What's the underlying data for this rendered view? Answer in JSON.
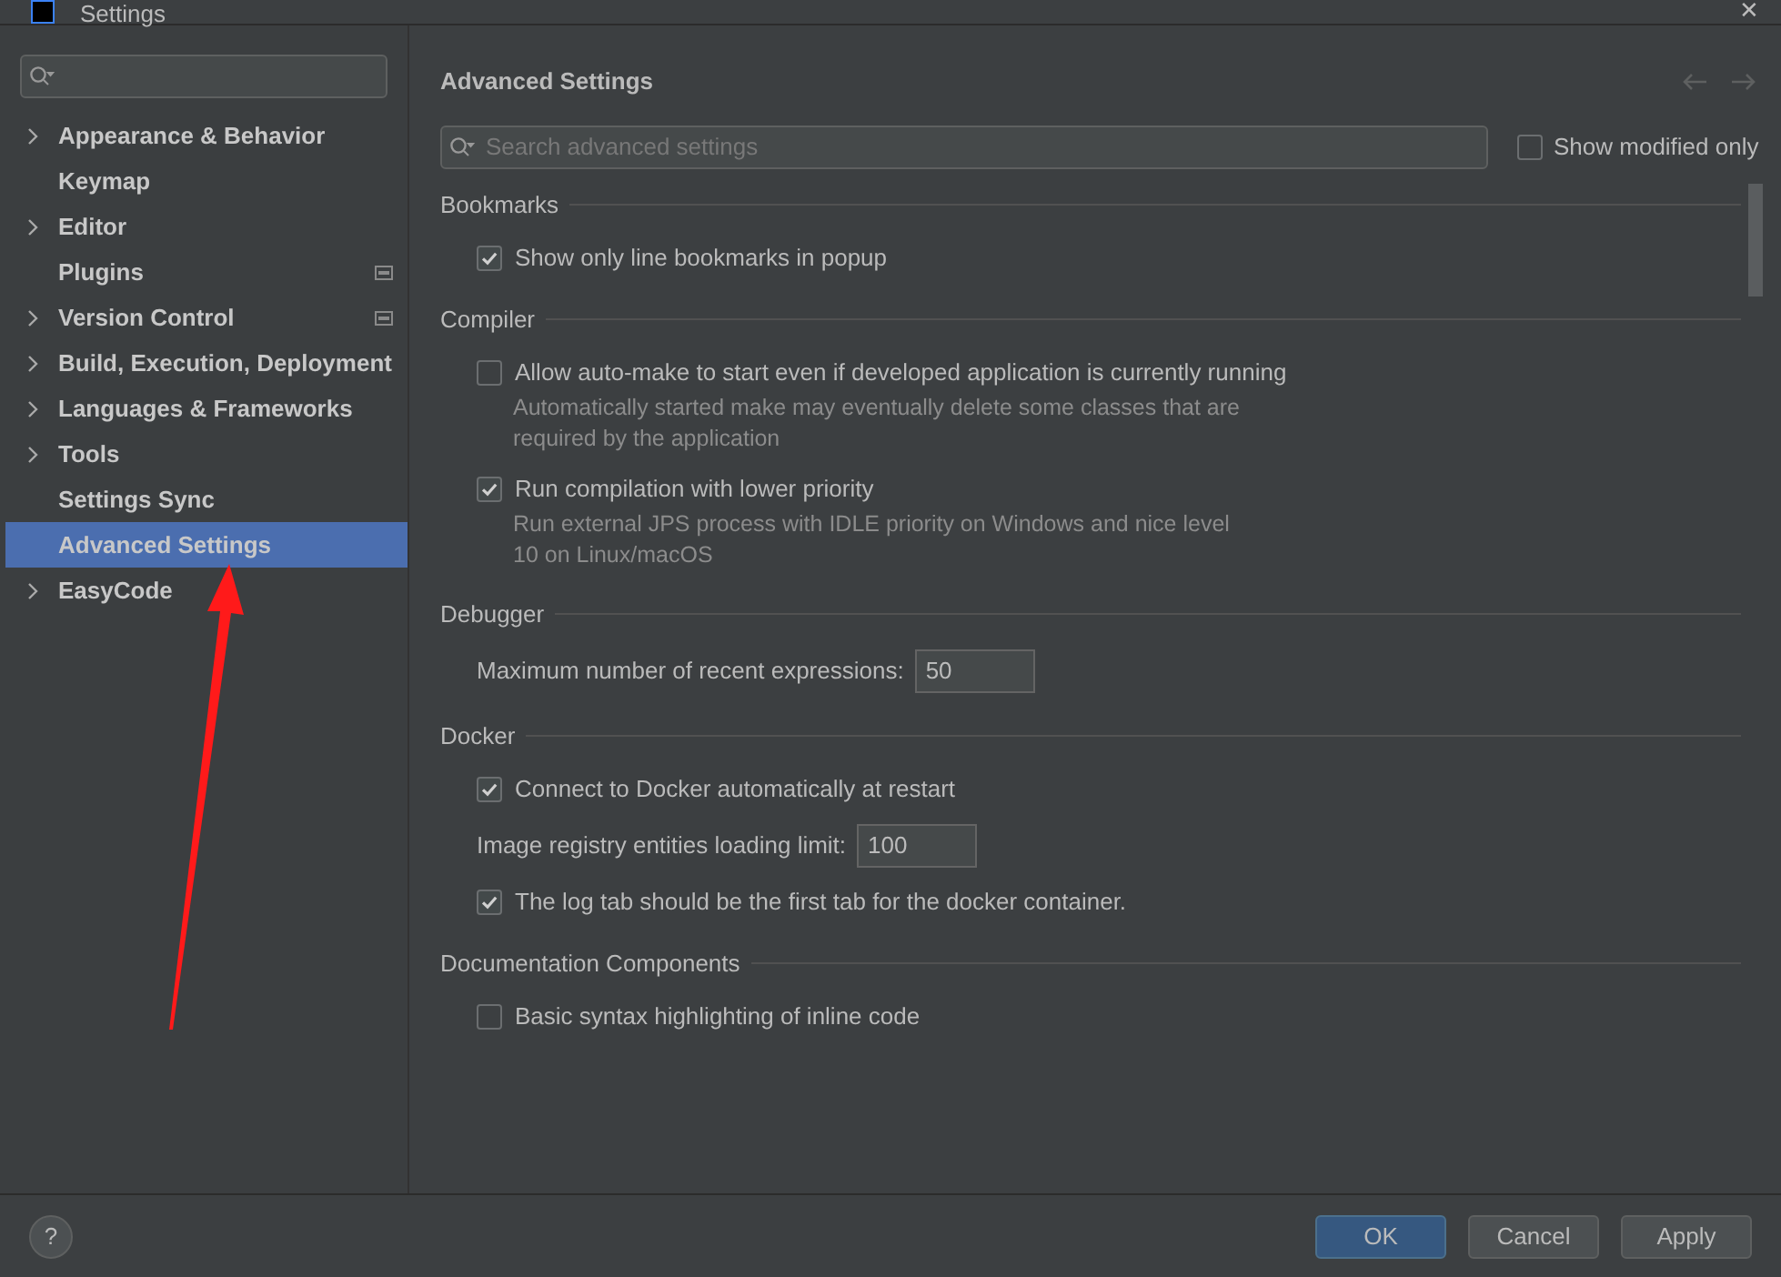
{
  "window": {
    "title": "Settings",
    "close": "✕"
  },
  "sidebar": {
    "items": [
      {
        "label": "Appearance & Behavior",
        "expandable": true,
        "selected": false,
        "badge": false
      },
      {
        "label": "Keymap",
        "expandable": false,
        "selected": false,
        "badge": false
      },
      {
        "label": "Editor",
        "expandable": true,
        "selected": false,
        "badge": false
      },
      {
        "label": "Plugins",
        "expandable": false,
        "selected": false,
        "badge": true
      },
      {
        "label": "Version Control",
        "expandable": true,
        "selected": false,
        "badge": true
      },
      {
        "label": "Build, Execution, Deployment",
        "expandable": true,
        "selected": false,
        "badge": false
      },
      {
        "label": "Languages & Frameworks",
        "expandable": true,
        "selected": false,
        "badge": false
      },
      {
        "label": "Tools",
        "expandable": true,
        "selected": false,
        "badge": false
      },
      {
        "label": "Settings Sync",
        "expandable": false,
        "selected": false,
        "badge": false
      },
      {
        "label": "Advanced Settings",
        "expandable": false,
        "selected": true,
        "badge": false
      },
      {
        "label": "EasyCode",
        "expandable": true,
        "selected": false,
        "badge": false
      }
    ]
  },
  "page": {
    "title": "Advanced Settings",
    "search": {
      "placeholder": "Search advanced settings"
    },
    "show_modified": {
      "label": "Show modified only",
      "checked": false
    },
    "sections": [
      {
        "title": "Bookmarks",
        "items": [
          {
            "kind": "checkbox",
            "label": "Show only line bookmarks in popup",
            "checked": true
          }
        ]
      },
      {
        "title": "Compiler",
        "items": [
          {
            "kind": "checkbox",
            "label": "Allow auto-make to start even if developed application is currently running",
            "checked": false,
            "description": "Automatically started make may eventually delete some classes that are required by the application"
          },
          {
            "kind": "checkbox",
            "label": "Run compilation with lower priority",
            "checked": true,
            "description": "Run external JPS process with IDLE priority on Windows and nice level 10 on Linux/macOS"
          }
        ]
      },
      {
        "title": "Debugger",
        "items": [
          {
            "kind": "number",
            "label": "Maximum number of recent expressions:",
            "value": "50"
          }
        ]
      },
      {
        "title": "Docker",
        "items": [
          {
            "kind": "checkbox",
            "label": "Connect to Docker automatically at restart",
            "checked": true
          },
          {
            "kind": "number",
            "label": "Image registry entities loading limit:",
            "value": "100"
          },
          {
            "kind": "checkbox",
            "label": "The log tab should be the first tab for the docker container.",
            "checked": true
          }
        ]
      },
      {
        "title": "Documentation Components",
        "items": [
          {
            "kind": "checkbox",
            "label": "Basic syntax highlighting of inline code",
            "checked": false
          }
        ]
      }
    ]
  },
  "footer": {
    "help": "?",
    "buttons": [
      {
        "label": "OK",
        "primary": true
      },
      {
        "label": "Cancel",
        "primary": false
      },
      {
        "label": "Apply",
        "primary": false
      }
    ]
  }
}
